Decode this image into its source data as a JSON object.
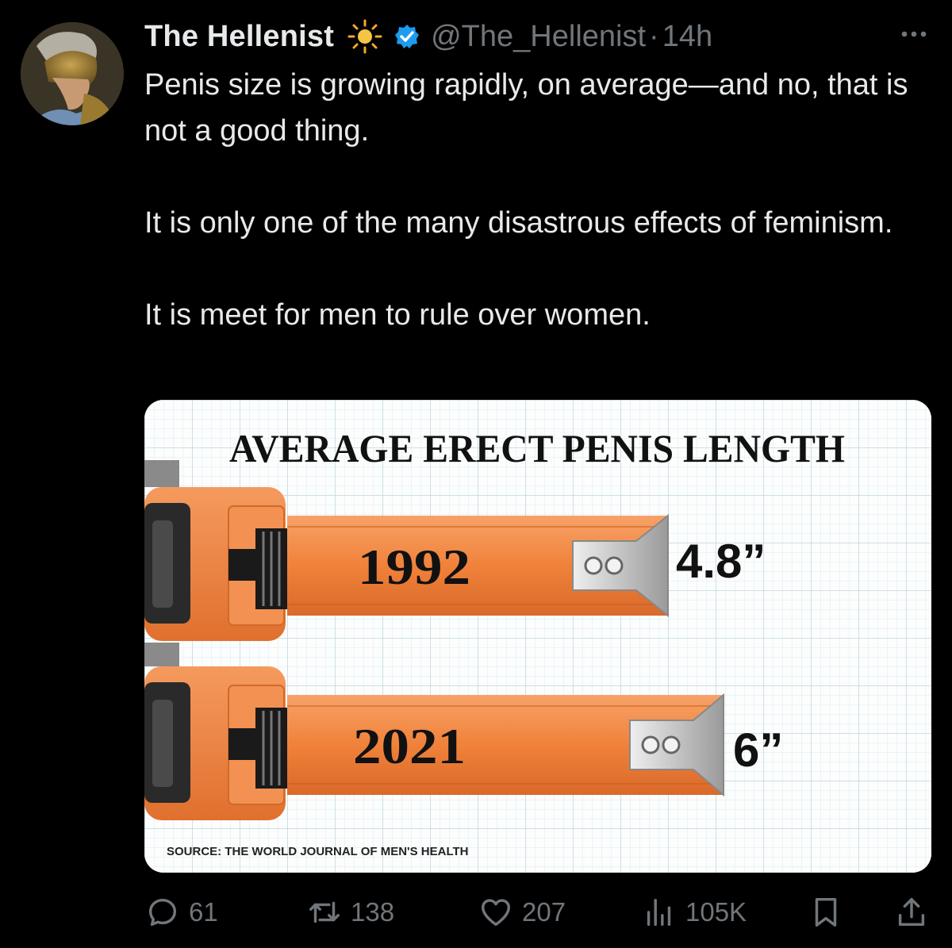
{
  "author": {
    "display_name": "The Hellenist",
    "handle": "@The_Hellenist",
    "separator": "·",
    "time": "14h",
    "badge_icon": "sun-icon",
    "verified_icon": "verified-check-icon",
    "verified_color": "#1d9bf0"
  },
  "tweet": {
    "paragraphs": [
      "Penis size is growing rapidly, on average—and no, that is not a good thing.",
      "It is only one of the many disastrous effects of feminism.",
      "It is meet for men to rule over women."
    ]
  },
  "infographic": {
    "title": "AVERAGE ERECT PENIS LENGTH",
    "source": "SOURCE: THE WORLD JOURNAL OF MEN'S HEALTH",
    "tapes": [
      {
        "year": "1992",
        "length_label": "4.8”",
        "value": 4.8
      },
      {
        "year": "2021",
        "length_label": "6”",
        "value": 6
      }
    ],
    "colors": {
      "tape": "#f0823a",
      "tape_dark": "#c85f1e",
      "grid": "#cfe3ea",
      "text": "#111111"
    }
  },
  "actions": {
    "replies": "61",
    "reposts": "138",
    "likes": "207",
    "views": "105K"
  },
  "theme": {
    "background": "#000000",
    "text": "#e7e9ea",
    "muted": "#71767b"
  }
}
